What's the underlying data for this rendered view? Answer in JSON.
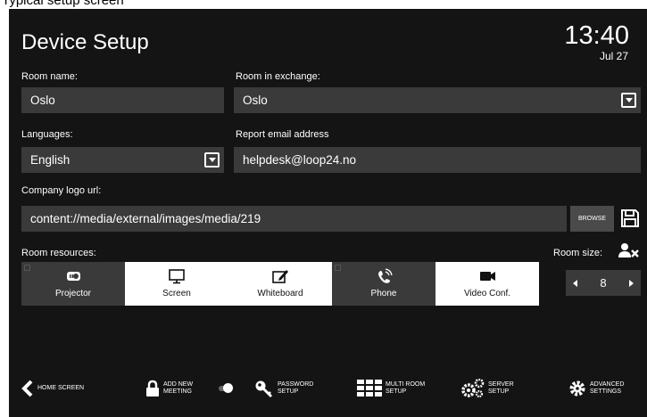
{
  "caption": "Typical setup screen",
  "header": {
    "title": "Device Setup",
    "time": "13:40",
    "date": "Jul 27"
  },
  "form": {
    "room_name": {
      "label": "Room name:",
      "value": "Oslo"
    },
    "room_exchange": {
      "label": "Room in exchange:",
      "value": "Oslo"
    },
    "languages": {
      "label": "Languages:",
      "value": "English"
    },
    "report_email": {
      "label": "Report email address",
      "value": "helpdesk@loop24.no"
    },
    "company_logo": {
      "label": "Company logo url:",
      "value": "content://media/external/images/media/219",
      "browse_label": "BROWSE"
    }
  },
  "resources": {
    "label": "Room resources:",
    "items": [
      {
        "label": "Projector",
        "icon": "projector-icon",
        "selected": false
      },
      {
        "label": "Screen",
        "icon": "monitor-icon",
        "selected": true
      },
      {
        "label": "Whiteboard",
        "icon": "edit-icon",
        "selected": true
      },
      {
        "label": "Phone",
        "icon": "phone-icon",
        "selected": false
      },
      {
        "label": "Video Conf.",
        "icon": "video-camera-icon",
        "selected": true
      }
    ]
  },
  "room_size": {
    "label": "Room size:",
    "value": "8"
  },
  "bottom_nav": {
    "home": {
      "line1": "HOME SCREEN",
      "line2": ""
    },
    "add_meeting": {
      "line1": "ADD NEW",
      "line2": "MEETING"
    },
    "password": {
      "line1": "PASSWORD",
      "line2": "SETUP"
    },
    "multi_room": {
      "line1": "MULTI ROOM",
      "line2": "SETUP"
    },
    "server": {
      "line1": "SERVER",
      "line2": "SETUP"
    },
    "advanced": {
      "line1": "ADVANCED",
      "line2": "SETTINGS"
    }
  },
  "colors": {
    "background": "#141414",
    "field": "#3a3a3a",
    "selected_tile": "#ffffff"
  }
}
